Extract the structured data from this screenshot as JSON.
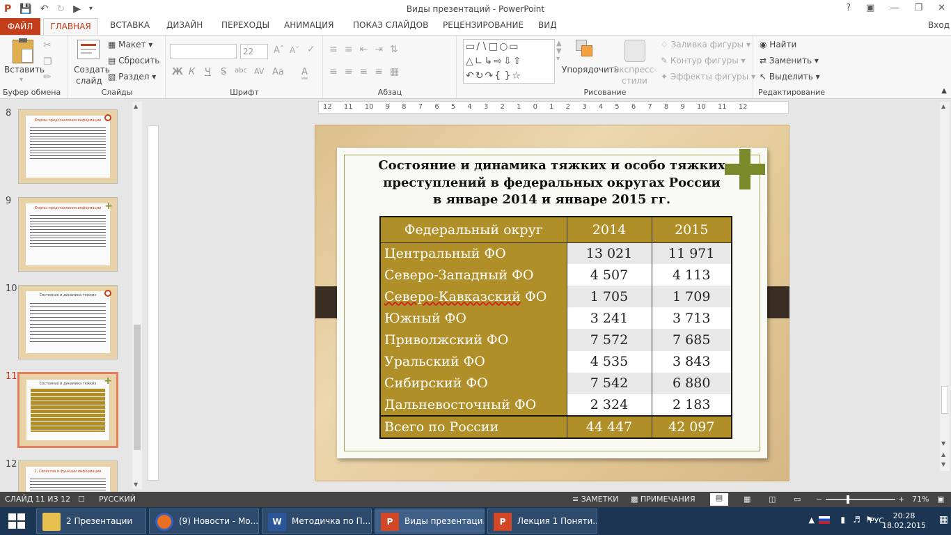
{
  "window": {
    "title": "Виды презентаций - PowerPoint",
    "signin": "Вход"
  },
  "tabs": [
    "ФАЙЛ",
    "ГЛАВНАЯ",
    "ВСТАВКА",
    "ДИЗАЙН",
    "ПЕРЕХОДЫ",
    "АНИМАЦИЯ",
    "ПОКАЗ СЛАЙДОВ",
    "РЕЦЕНЗИРОВАНИЕ",
    "ВИД"
  ],
  "ribbon": {
    "clipboard": {
      "paste": "Вставить",
      "label": "Буфер обмена"
    },
    "slides": {
      "create": "Создать",
      "create2": "слайд",
      "layout": "Макет",
      "reset": "Сбросить",
      "section": "Раздел",
      "label": "Слайды"
    },
    "font": {
      "size": "22",
      "label": "Шрифт",
      "bold": "Ж",
      "italic": "К",
      "underline": "Ч",
      "strike": "S",
      "shadow": "abc",
      "spacing": "AV",
      "case": "Aa",
      "color": "A"
    },
    "paragraph": {
      "label": "Абзац"
    },
    "drawing": {
      "arrange": "Упорядочить",
      "styles": "Экспресс-",
      "styles2": "стили",
      "fill": "Заливка фигуры",
      "outline": "Контур фигуры",
      "effects": "Эффекты фигуры",
      "label": "Рисование"
    },
    "editing": {
      "find": "Найти",
      "replace": "Заменить",
      "select": "Выделить",
      "label": "Редактирование"
    }
  },
  "thumbnails": [
    {
      "num": "8",
      "title": "Формы представления информации"
    },
    {
      "num": "9",
      "title": "Формы представления информации"
    },
    {
      "num": "10",
      "title": "Состояние и динамика тяжких"
    },
    {
      "num": "11",
      "title": "Состояние и динамика тяжких"
    },
    {
      "num": "12",
      "title": "2. Свойства и функции информации"
    }
  ],
  "ruler": {
    "h": "12 11 10 9 8 7 6 5 4 3 2 1 0 1 2 3 4 5 6 7 8 9 10 11 12"
  },
  "slide": {
    "heading": [
      "Состояние и динамика тяжких и особо тяжких",
      "преступлений в федеральных округах России",
      "в январе 2014 и январе 2015 гг."
    ],
    "table": {
      "headers": [
        "Федеральный округ",
        "2014",
        "2015"
      ],
      "rows": [
        {
          "region": "Центральный ФО",
          "y2014": "13 021",
          "y2015": "11 971"
        },
        {
          "region": "Северо-Западный ФО",
          "y2014": "4 507",
          "y2015": "4 113"
        },
        {
          "region_a": "Северо-Кавказский",
          "region_b": " ФО",
          "y2014": "1 705",
          "y2015": "1 709"
        },
        {
          "region": "Южный ФО",
          "y2014": "3 241",
          "y2015": "3 713"
        },
        {
          "region": "Приволжский ФО",
          "y2014": "7 572",
          "y2015": "7 685"
        },
        {
          "region": "Уральский ФО",
          "y2014": "4 535",
          "y2015": "3 843"
        },
        {
          "region": "Сибирский ФО",
          "y2014": "7 542",
          "y2015": "6 880"
        },
        {
          "region": "Дальневосточный ФО",
          "y2014": "2 324",
          "y2015": "2 183"
        }
      ],
      "total": {
        "region": "Всего по России",
        "y2014": "44 447",
        "y2015": "42 097"
      }
    }
  },
  "status": {
    "slide": "СЛАЙД 11 ИЗ 12",
    "lang": "РУССКИЙ",
    "notes": "ЗАМЕТКИ",
    "comments": "ПРИМЕЧАНИЯ",
    "zoom": "71%"
  },
  "taskbar": {
    "items": [
      "2 Презентации",
      "(9) Новости - Мо...",
      "Методичка по П...",
      "Виды презентаци...",
      "Лекция 1 Поняти..."
    ],
    "lang": "РУС",
    "time": "20:28",
    "date": "18.02.2015"
  },
  "colors": {
    "accent": "#c43e1c",
    "gold": "#b08f28",
    "olive": "#7a8a2a"
  }
}
